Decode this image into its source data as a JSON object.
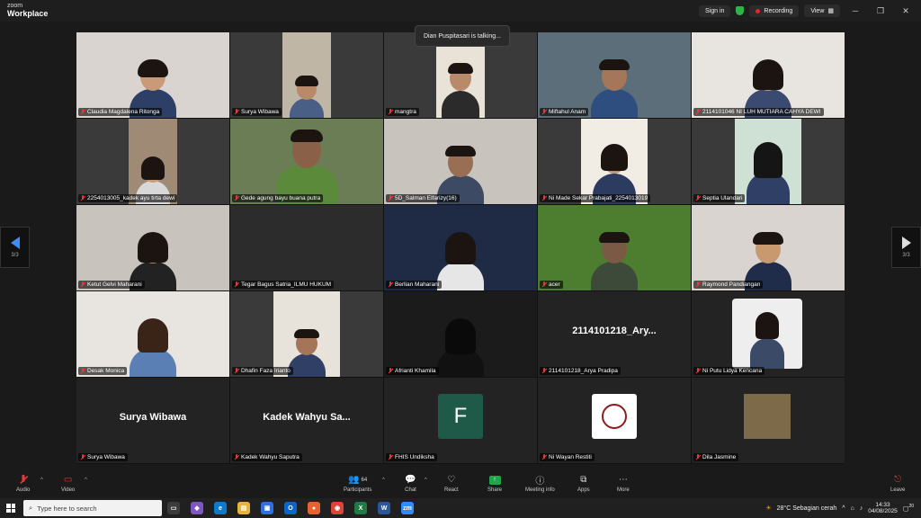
{
  "app": {
    "logo_top": "zoom",
    "logo_bottom": "Workplace",
    "sign_in": "Sign in",
    "recording": "Recording",
    "view": "View"
  },
  "speaking_indicator": "Dian Puspitasari is talking...",
  "pager": {
    "left_text": "3/3",
    "right_text": "3/3"
  },
  "participants": [
    {
      "name": "Claudia Magdalena Ritonga"
    },
    {
      "name": "Surya Wibawa"
    },
    {
      "name": "mangtra"
    },
    {
      "name": "Miftahul Anam"
    },
    {
      "name": "2114101046 NI LUH MUTIARA CAHYA DEWI"
    },
    {
      "name": "2254013005_kadek ayu tirta dewi"
    },
    {
      "name": "Gede agung bayu buana putra"
    },
    {
      "name": "5D_Salman Elfarizy(16)"
    },
    {
      "name": "Ni Made Sekar Prabajati_2254013019"
    },
    {
      "name": "Septia Ulandari"
    },
    {
      "name": "Ketut Gelvi Maharani"
    },
    {
      "name": "Tegar Bagus Satria_ILMU HUKUM"
    },
    {
      "name": "Berlian Maharani"
    },
    {
      "name": "acer"
    },
    {
      "name": "Raymond Pandiangan"
    },
    {
      "name": "Desak Monica"
    },
    {
      "name": "Dhafin Faza Irianto"
    },
    {
      "name": "Afrianti Khamila"
    },
    {
      "name": "2114101218_Arya Pradipa",
      "display": "2114101218_Ary..."
    },
    {
      "name": "Ni Putu Lidya Kencana"
    },
    {
      "name": "Surya Wibawa",
      "display": "Surya Wibawa"
    },
    {
      "name": "Kadek Wahyu Saputra",
      "display": "Kadek Wahyu Sa..."
    },
    {
      "name": "FHIS Undiksha",
      "avatar_letter": "F"
    },
    {
      "name": "Ni Wayan Restiti"
    },
    {
      "name": "Dila Jasmine"
    }
  ],
  "toolbar": {
    "audio": "Audio",
    "video": "Video",
    "participants": "Participants",
    "participants_count": "64",
    "chat": "Chat",
    "react": "React",
    "share": "Share",
    "meeting_info": "Meeting info",
    "apps": "Apps",
    "more": "More",
    "leave": "Leave"
  },
  "taskbar": {
    "search_placeholder": "Type here to search",
    "weather": "28°C  Sebagian cerah",
    "time": "14:33",
    "date": "04/08/2025",
    "notif_count": "20"
  }
}
